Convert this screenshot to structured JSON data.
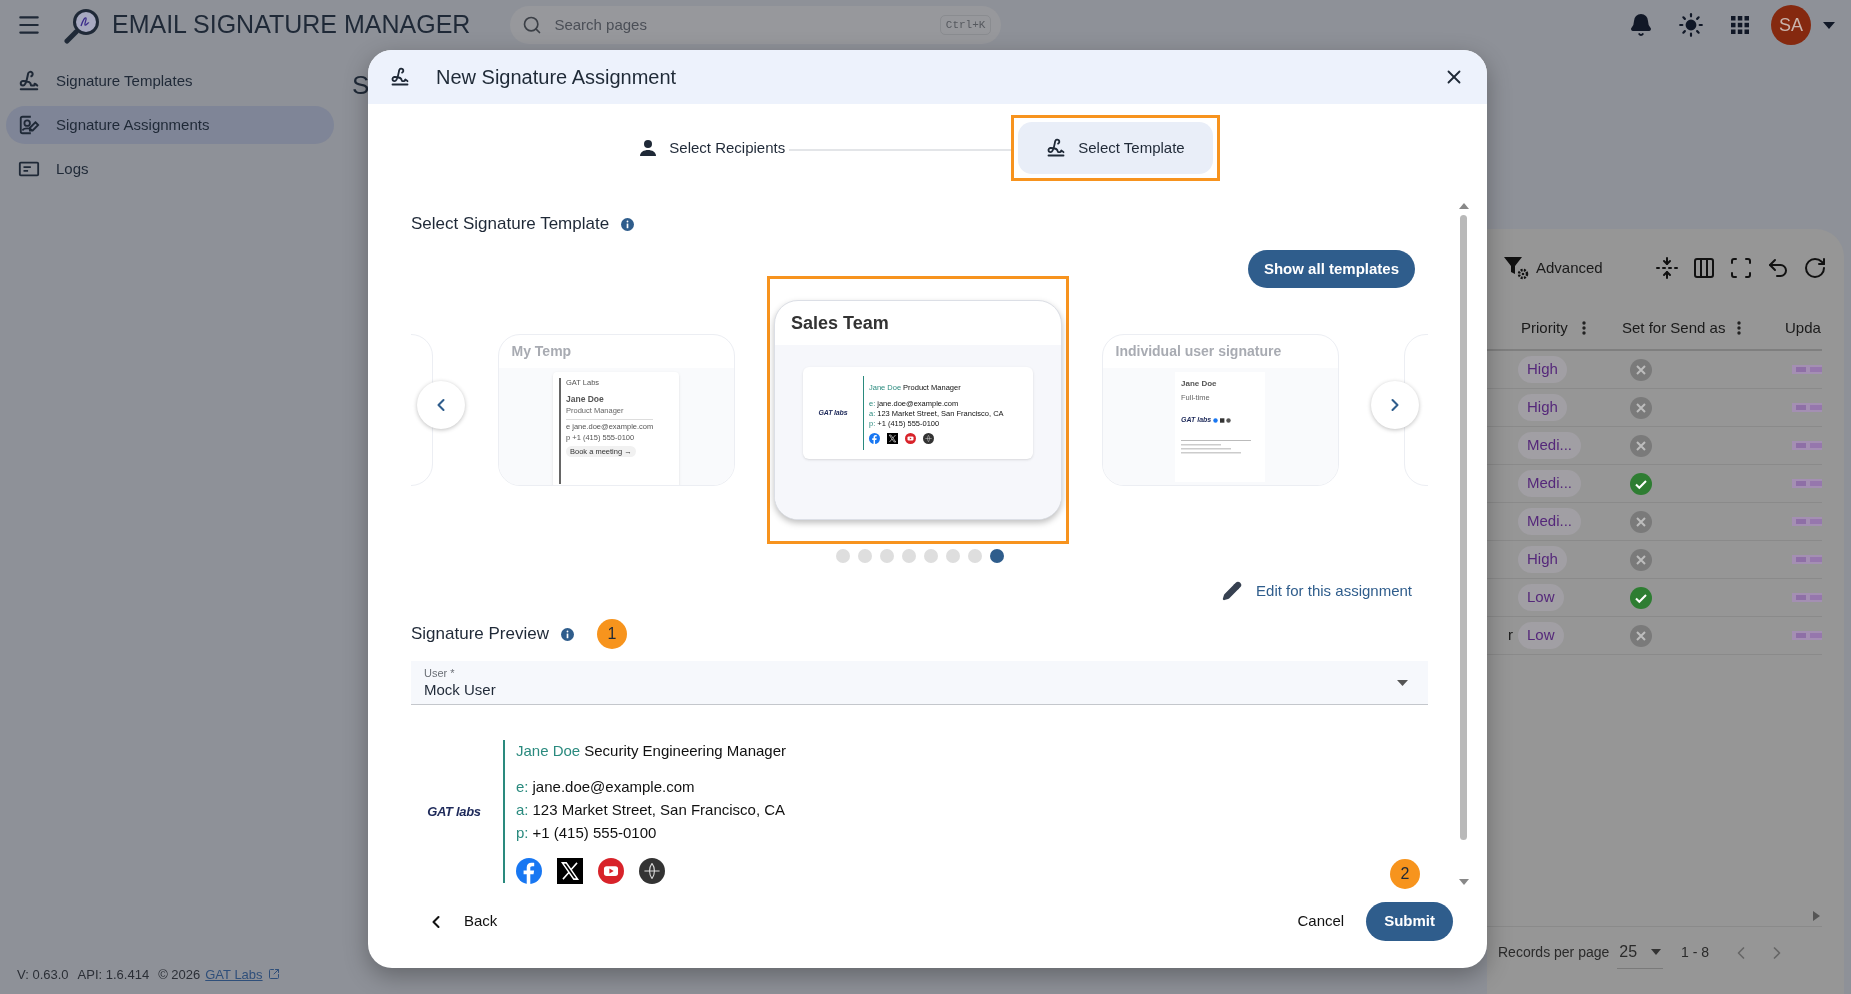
{
  "app": {
    "title": "EMAIL SIGNATURE MANAGER",
    "search": {
      "placeholder": "Search pages",
      "shortcut": "Ctrl+K"
    },
    "avatar": "SA"
  },
  "sidebar": {
    "items": [
      {
        "kind": "templates",
        "label": "Signature Templates",
        "selected": false
      },
      {
        "kind": "assignments",
        "label": "Signature Assignments",
        "selected": true
      },
      {
        "kind": "logs",
        "label": "Logs",
        "selected": false
      }
    ]
  },
  "page_heading": "S",
  "footer": {
    "version": "V: 0.63.0",
    "api": "API: 1.6.414",
    "copyright": "© 2026",
    "link": "GAT Labs"
  },
  "table": {
    "toolbar": {
      "filter": "Advanced"
    },
    "columns": [
      {
        "label": "Priority",
        "has_menu": true
      },
      {
        "label": "Set for Send as",
        "has_menu": true
      },
      {
        "label": "Upda",
        "has_menu": false
      }
    ],
    "rows": [
      {
        "priority": "High",
        "set_for_send_as": false
      },
      {
        "priority": "High",
        "set_for_send_as": false
      },
      {
        "priority": "Medi...",
        "set_for_send_as": false
      },
      {
        "priority": "Medi...",
        "set_for_send_as": true
      },
      {
        "priority": "Medi...",
        "set_for_send_as": false
      },
      {
        "priority": "High",
        "set_for_send_as": false
      },
      {
        "priority": "Low",
        "set_for_send_as": true
      },
      {
        "priority": "Low",
        "set_for_send_as": false,
        "cut_text": "r"
      }
    ],
    "pagination": {
      "label": "Records per page",
      "per_page": "25",
      "range": "1 - 8"
    }
  },
  "dialog": {
    "title": "New Signature Assignment",
    "steps": [
      {
        "kind": "recipients",
        "label": "Select Recipients",
        "selected": false,
        "highlighted": false
      },
      {
        "kind": "template",
        "label": "Select Template",
        "selected": true,
        "highlighted": true
      }
    ],
    "template_section": {
      "heading": "Select Signature Template",
      "show_all": "Show all templates",
      "cards": [
        {
          "kind": "edge"
        },
        {
          "kind": "template",
          "title": "My Temp",
          "selected": false,
          "highlighted": false,
          "preview": {
            "kind": "bar",
            "company": "GAT Labs",
            "name": "Jane Doe",
            "role": "Product Manager",
            "lines": [
              {
                "label": "e",
                "value": "jane.doe@example.com"
              },
              {
                "label": "p",
                "value": "+1 (415) 555-0100"
              }
            ],
            "button": "Book a meeting →"
          }
        },
        {
          "kind": "template",
          "title": "Sales Team",
          "selected": true,
          "highlighted": true,
          "preview": {
            "kind": "logo_left",
            "logo": "GAT labs",
            "name": "Jane Doe",
            "role": "Product Manager",
            "lines": [
              {
                "label": "e:",
                "value": "jane.doe@example.com"
              },
              {
                "label": "a:",
                "value": "123 Market Street, San Francisco, CA"
              },
              {
                "label": "p:",
                "value": "+1 (415) 555-0100"
              }
            ],
            "socials": [
              {
                "kind": "facebook"
              },
              {
                "kind": "x"
              },
              {
                "kind": "youtube"
              },
              {
                "kind": "web"
              }
            ]
          }
        },
        {
          "kind": "template",
          "title": "Individual user signature",
          "selected": false,
          "highlighted": false,
          "preview": {
            "kind": "logo_center",
            "name": "Jane Doe",
            "role": "Full-time",
            "logo": "GAT labs"
          }
        },
        {
          "kind": "edge"
        }
      ],
      "dots": [
        {
          "selected": false
        },
        {
          "selected": false
        },
        {
          "selected": false
        },
        {
          "selected": false
        },
        {
          "selected": false
        },
        {
          "selected": false
        },
        {
          "selected": false
        },
        {
          "selected": true
        }
      ]
    },
    "edit_link": "Edit for this assignment",
    "preview_section": {
      "heading": "Signature Preview",
      "badge": "1",
      "user_field": {
        "label": "User *",
        "value": "Mock User"
      },
      "signature": {
        "kind": "logo_left",
        "logo": "GAT labs",
        "name": "Jane Doe",
        "role": "Security Engineering Manager",
        "lines": [
          {
            "label": "e:",
            "value": "jane.doe@example.com"
          },
          {
            "label": "a:",
            "value": "123 Market Street, San Francisco, CA"
          },
          {
            "label": "p:",
            "value": "+1 (415) 555-0100"
          }
        ],
        "socials": [
          {
            "kind": "facebook"
          },
          {
            "kind": "x"
          },
          {
            "kind": "youtube"
          },
          {
            "kind": "web"
          }
        ]
      }
    },
    "footer": {
      "back": "Back",
      "cancel": "Cancel",
      "submit": "Submit",
      "badge": "2"
    }
  }
}
